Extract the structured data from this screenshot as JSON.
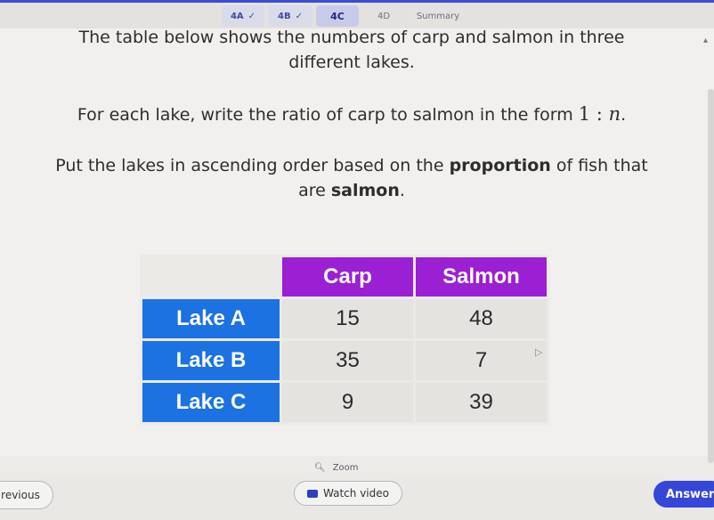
{
  "tabs": [
    {
      "label": "4A",
      "done": true
    },
    {
      "label": "4B",
      "done": true
    },
    {
      "label": "4C",
      "done": false
    },
    {
      "label": "4D",
      "done": false
    },
    {
      "label": "Summary",
      "done": false
    }
  ],
  "question": {
    "line1": "The table below shows the numbers of carp and salmon in three",
    "line2": "different lakes.",
    "instruction1_text": "For each lake, write the ratio of carp to salmon in the form ",
    "instruction1_math_lead": "1 : ",
    "instruction1_math_var": "n",
    "instruction1_end": ".",
    "instruction2_pre": "Put the lakes in ascending order based on the ",
    "instruction2_bold1": "proportion",
    "instruction2_mid": " of fish that",
    "instruction2_line2_pre": "are ",
    "instruction2_bold2": "salmon",
    "instruction2_end": "."
  },
  "table": {
    "headers": [
      "Carp",
      "Salmon"
    ],
    "rows": [
      {
        "lake": "Lake A",
        "carp": "15",
        "salmon": "48"
      },
      {
        "lake": "Lake B",
        "carp": "35",
        "salmon": "7"
      },
      {
        "lake": "Lake C",
        "carp": "9",
        "salmon": "39"
      }
    ],
    "colors": {
      "header": "#9b1fd3",
      "row_header": "#1c72e0"
    }
  },
  "zoom_label": "Zoom",
  "buttons": {
    "previous": "revious",
    "watch_video": "Watch video",
    "answer": "Answer"
  },
  "icons": {
    "check": "check-icon",
    "zoom": "magnifier-icon",
    "video": "video-icon"
  },
  "colors": {
    "accent": "#3447d8"
  }
}
